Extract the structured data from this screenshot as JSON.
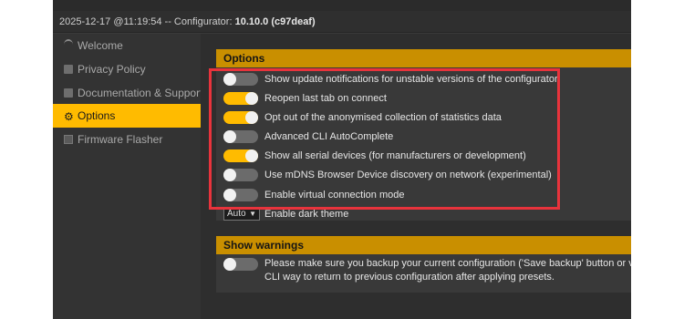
{
  "titlebar": {
    "prefix": "2025-12-17 @11:19:54 -- Configurator: ",
    "version": "10.10.0 (c97deaf)"
  },
  "sidebar": {
    "items": [
      {
        "label": "Welcome",
        "icon": "welcome-icon",
        "active": false
      },
      {
        "label": "Privacy Policy",
        "icon": "document-icon",
        "active": false
      },
      {
        "label": "Documentation & Support",
        "icon": "document-icon",
        "active": false
      },
      {
        "label": "Options",
        "icon": "gear-icon",
        "active": true
      },
      {
        "label": "Firmware Flasher",
        "icon": "chip-icon",
        "active": false
      }
    ]
  },
  "options": {
    "title": "Options",
    "items": [
      {
        "label": "Show update notifications for unstable versions of the configurator",
        "on": false
      },
      {
        "label": "Reopen last tab on connect",
        "on": true
      },
      {
        "label": "Opt out of the anonymised collection of statistics data",
        "on": true
      },
      {
        "label": "Advanced CLI AutoComplete",
        "on": false
      },
      {
        "label": "Show all serial devices (for manufacturers or development)",
        "on": true
      },
      {
        "label": "Use mDNS Browser Device discovery on network (experimental)",
        "on": false
      },
      {
        "label": "Enable virtual connection mode",
        "on": false
      }
    ],
    "dark_theme": {
      "selected": "Auto",
      "label": "Enable dark theme"
    }
  },
  "warnings": {
    "title": "Show warnings",
    "on": false,
    "text": "Please make sure you backup your current configuration ('Save backup' button or via CLI way to return to previous configuration after applying presets."
  },
  "colors": {
    "accent": "#ffbb00",
    "panel_header": "#c98f00",
    "highlight_box": "#e8333c"
  }
}
